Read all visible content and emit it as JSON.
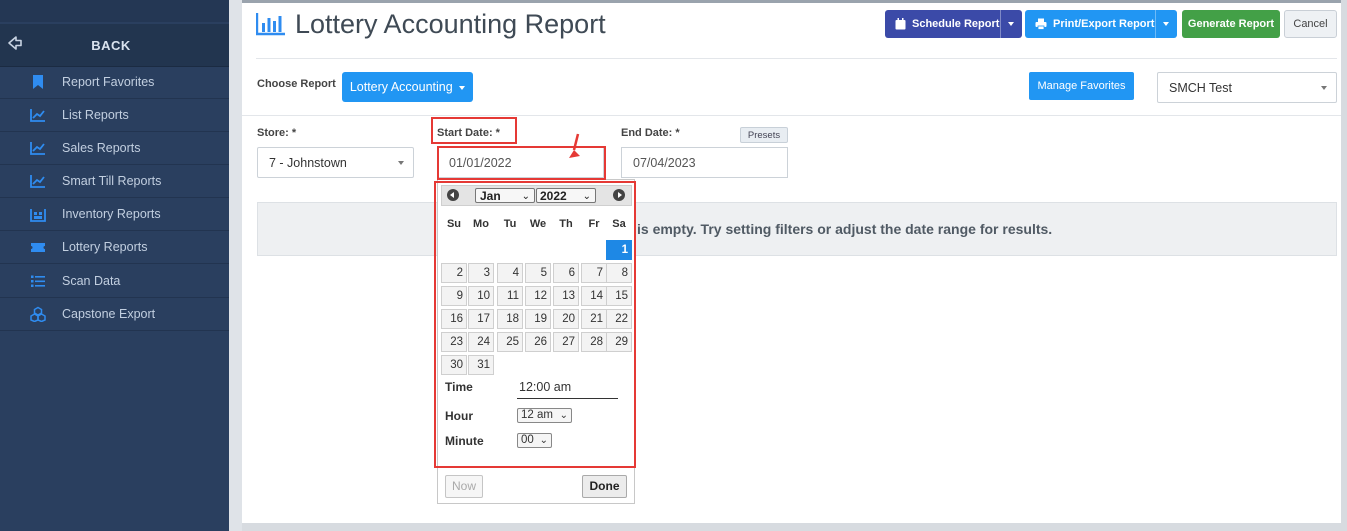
{
  "sidebar": {
    "back_label": "BACK",
    "items": [
      {
        "label": "Report Favorites",
        "icon": "bookmark-icon"
      },
      {
        "label": "List Reports",
        "icon": "line-chart-icon"
      },
      {
        "label": "Sales Reports",
        "icon": "line-chart-icon"
      },
      {
        "label": "Smart Till Reports",
        "icon": "line-chart-icon"
      },
      {
        "label": "Inventory Reports",
        "icon": "warehouse-icon"
      },
      {
        "label": "Lottery Reports",
        "icon": "ticket-icon"
      },
      {
        "label": "Scan Data",
        "icon": "list-icon"
      },
      {
        "label": "Capstone Export",
        "icon": "boxes-icon"
      }
    ],
    "icon_color": "#2f8cf0"
  },
  "header": {
    "title": "Lottery Accounting Report",
    "schedule_label": "Schedule Report",
    "print_label": "Print/Export Report",
    "generate_label": "Generate Report",
    "cancel_label": "Cancel"
  },
  "report_bar": {
    "choose_label": "Choose Report",
    "report_value": "Lottery Accounting",
    "manage_label": "Manage Favorites",
    "company_value": "SMCH Test"
  },
  "filters": {
    "store_label": "Store: *",
    "store_value": "7 - Johnstown",
    "start_label": "Start Date: *",
    "start_value": "01/01/2022",
    "end_label": "End Date: *",
    "end_value": "07/04/2023",
    "presets_label": "Presets"
  },
  "empty_message": "is empty. Try setting filters or adjust the date range for results.",
  "datepicker": {
    "month": "Jan",
    "year": "2022",
    "weekdays": [
      "Su",
      "Mo",
      "Tu",
      "We",
      "Th",
      "Fr",
      "Sa"
    ],
    "selected_day": "1",
    "weeks": [
      [
        "",
        "",
        "",
        "",
        "",
        "",
        "1"
      ],
      [
        "2",
        "3",
        "4",
        "5",
        "6",
        "7",
        "8"
      ],
      [
        "9",
        "10",
        "11",
        "12",
        "13",
        "14",
        "15"
      ],
      [
        "16",
        "17",
        "18",
        "19",
        "20",
        "21",
        "22"
      ],
      [
        "23",
        "24",
        "25",
        "26",
        "27",
        "28",
        "29"
      ],
      [
        "30",
        "31",
        "",
        "",
        "",
        "",
        ""
      ]
    ],
    "time_label": "Time",
    "time_value": "12:00 am",
    "hour_label": "Hour",
    "hour_value": "12 am",
    "minute_label": "Minute",
    "minute_value": "00",
    "now_label": "Now",
    "done_label": "Done"
  },
  "colors": {
    "sidebar_bg": "#2a3f5f",
    "primary_blue": "#2196f3",
    "schedule_blue": "#3b4aa8",
    "generate_green": "#43a047",
    "highlight_red": "#e53935"
  }
}
